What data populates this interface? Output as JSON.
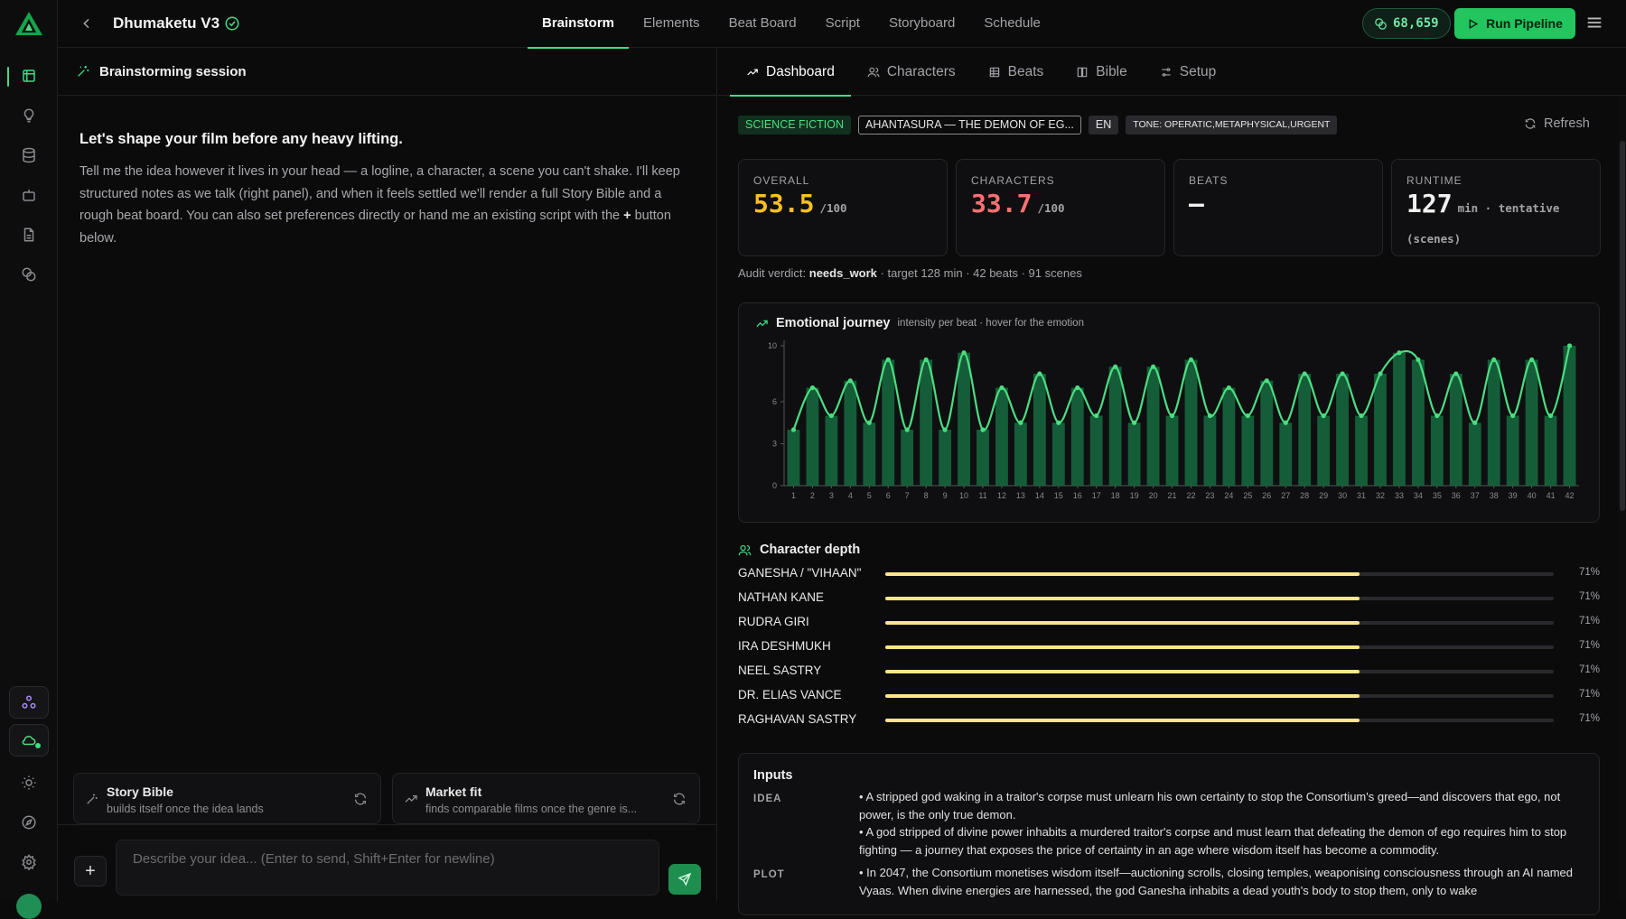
{
  "project": {
    "title": "Dhumaketu V3"
  },
  "nav": {
    "tabs": [
      "Brainstorm",
      "Elements",
      "Beat Board",
      "Script",
      "Storyboard",
      "Schedule"
    ],
    "active": "Brainstorm"
  },
  "credits": "68,659",
  "run_label": "Run Pipeline",
  "chat": {
    "header": "Brainstorming session",
    "intro_title": "Let's shape your film before any heavy lifting.",
    "intro_text_a": "Tell me the idea however it lives in your head — a logline, a character, a scene you can't shake. I'll keep structured notes as we talk (right panel), and when it feels settled we'll render a full Story Bible and a rough beat board. You can also set preferences directly or hand me an existing script with the ",
    "intro_plus": "+",
    "intro_text_b": " button below.",
    "cards": [
      {
        "title": "Story Bible",
        "subtitle": "builds itself once the idea lands"
      },
      {
        "title": "Market fit",
        "subtitle": "finds comparable films once the genre is..."
      }
    ],
    "input_placeholder": "Describe your idea... (Enter to send, Shift+Enter for newline)",
    "plus_label": "+"
  },
  "panel": {
    "tabs": [
      "Dashboard",
      "Characters",
      "Beats",
      "Bible",
      "Setup"
    ],
    "active_tab": "Dashboard",
    "tags": {
      "genre": "SCIENCE FICTION",
      "title": "AHANTASURA — THE DEMON OF EG...",
      "lang": "EN",
      "tone": "TONE: OPERATIC,METAPHYSICAL,URGENT"
    },
    "refresh": "Refresh",
    "stats": {
      "overall": {
        "label": "OVERALL",
        "value": "53.5",
        "unit": "/100"
      },
      "characters": {
        "label": "CHARACTERS",
        "value": "33.7",
        "unit": "/100"
      },
      "beats": {
        "label": "BEATS",
        "value": "—"
      },
      "runtime": {
        "label": "RUNTIME",
        "value": "127",
        "unit": "min · tentative (scenes)"
      }
    },
    "audit": {
      "prefix": "Audit verdict: ",
      "verdict": "needs_work",
      "suffix": " · target 128 min · 42 beats · 91 scenes"
    },
    "journey": {
      "title": "Emotional journey",
      "subtitle": "intensity per beat · hover for the emotion"
    },
    "depth_title": "Character depth",
    "characters": [
      {
        "name": "GANESHA / \"VIHAAN\"",
        "pct": "71%",
        "value": 0.71
      },
      {
        "name": "NATHAN KANE",
        "pct": "71%",
        "value": 0.71
      },
      {
        "name": "RUDRA GIRI",
        "pct": "71%",
        "value": 0.71
      },
      {
        "name": "IRA DESHMUKH",
        "pct": "71%",
        "value": 0.71
      },
      {
        "name": "NEEL SASTRY",
        "pct": "71%",
        "value": 0.71
      },
      {
        "name": "DR. ELIAS VANCE",
        "pct": "71%",
        "value": 0.71
      },
      {
        "name": "RAGHAVAN SASTRY",
        "pct": "71%",
        "value": 0.71
      }
    ],
    "inputs": {
      "title": "Inputs",
      "idea_label": "IDEA",
      "idea_1": "• A stripped god waking in a traitor's corpse must unlearn his own certainty to stop the Consortium's greed—and discovers that ego, not power, is the only true demon.",
      "idea_2": "• A god stripped of divine power inhabits a murdered traitor's corpse and must learn that defeating the demon of ego requires him to stop fighting — a journey that exposes the price of certainty in an age where wisdom itself has become a commodity.",
      "plot_label": "PLOT",
      "plot_1": "• In 2047, the Consortium monetises wisdom itself—auctioning scrolls, closing temples, weaponising consciousness through an AI named Vyaas. When divine energies are harnessed, the god Ganesha inhabits a dead youth's body to stop them, only to wake"
    }
  },
  "colors": {
    "accent": "#3ddc84",
    "overall": "#fbbf24",
    "characters": "#f87171",
    "bar": "#fde68a"
  },
  "chart_data": {
    "type": "bar+line",
    "title": "Emotional journey",
    "xlabel": "",
    "ylabel": "",
    "ylim": [
      0,
      10
    ],
    "yticks": [
      0,
      3,
      6,
      10
    ],
    "categories": [
      "1",
      "2",
      "3",
      "4",
      "5",
      "6",
      "7",
      "8",
      "9",
      "10",
      "11",
      "12",
      "13",
      "14",
      "15",
      "16",
      "17",
      "18",
      "19",
      "20",
      "21",
      "22",
      "23",
      "24",
      "25",
      "26",
      "27",
      "28",
      "29",
      "30",
      "31",
      "32",
      "33",
      "34",
      "35",
      "36",
      "37",
      "38",
      "39",
      "40",
      "41",
      "42"
    ],
    "values": [
      4,
      7,
      5,
      7.5,
      4.5,
      9,
      4,
      9,
      4,
      9.5,
      4,
      7,
      4.5,
      8,
      4.5,
      7,
      5,
      8.5,
      4.5,
      8.5,
      5,
      9,
      5,
      7,
      5,
      7.5,
      4.5,
      8,
      5,
      8,
      5,
      8,
      9.5,
      9,
      5,
      8,
      4.5,
      9,
      5,
      9,
      5,
      10
    ]
  }
}
